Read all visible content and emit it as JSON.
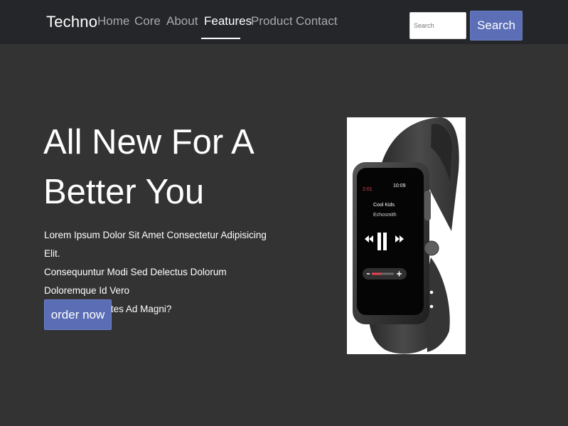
{
  "navbar": {
    "brand": "Techno",
    "links": [
      {
        "label": "Home",
        "active": false
      },
      {
        "label": "Core",
        "active": false
      },
      {
        "label": "About",
        "active": false
      },
      {
        "label": "Features",
        "active": true
      },
      {
        "label": "Product",
        "active": false
      },
      {
        "label": "Contact",
        "active": false
      }
    ],
    "search": {
      "placeholder": "Search",
      "button_label": "Search"
    }
  },
  "hero": {
    "title_line1": "All New For A",
    "title_line2": "Better You",
    "text_line1": "Lorem Ipsum Dolor Sit Amet Consectetur Adipisicing Elit.",
    "text_line2": "Consequuntur Modi Sed Delectus Dolorum Doloremque Id Vero",
    "text_line3": "Deleniti Voluptates Ad Magni?",
    "button_label": "order now"
  },
  "product_image": {
    "screen": {
      "left_time": "2:01",
      "right_time": "10:09",
      "track_title": "Cool Kids",
      "track_artist": "Echosmith"
    }
  },
  "colors": {
    "page_background": "#333333",
    "navbar_background": "#24262a",
    "accent_button": "#5b6eb6",
    "nav_link": "#a7a9ad",
    "nav_link_active": "#ffffff",
    "watch_band": "#3a3a3a",
    "watch_time_red": "#e34552"
  }
}
